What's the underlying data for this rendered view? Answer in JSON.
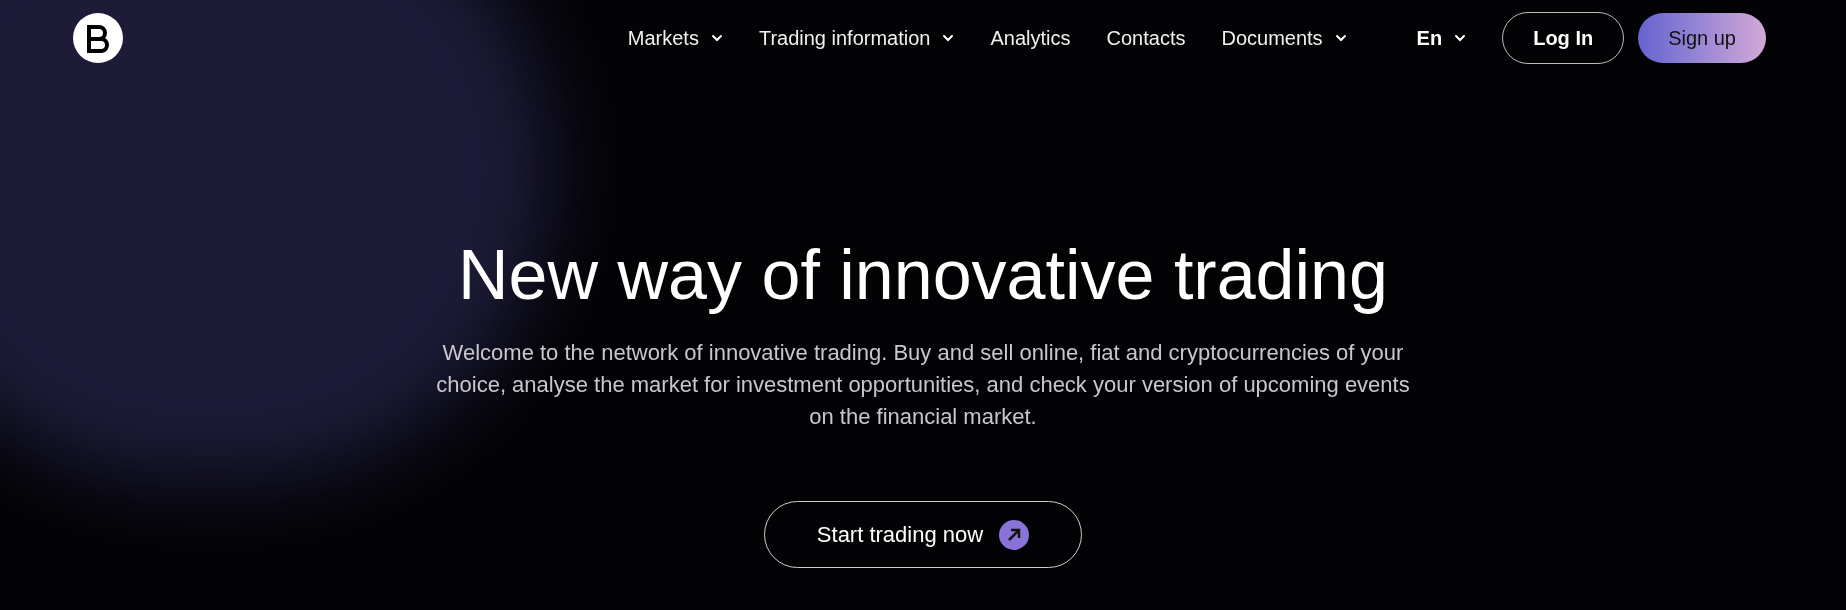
{
  "nav": {
    "items": [
      {
        "label": "Markets",
        "has_menu": true
      },
      {
        "label": "Trading information",
        "has_menu": true
      },
      {
        "label": "Analytics",
        "has_menu": false
      },
      {
        "label": "Contacts",
        "has_menu": false
      },
      {
        "label": "Documents",
        "has_menu": true
      }
    ],
    "language": "En",
    "login": "Log In",
    "signup": "Sign up"
  },
  "hero": {
    "title": "New way of innovative trading",
    "description": "Welcome to the network of innovative trading. Buy and sell online, fiat and cryptocurrencies of your choice, analyse the market for investment opportunities, and check your version of upcoming events on the financial market.",
    "cta": "Start trading now"
  }
}
